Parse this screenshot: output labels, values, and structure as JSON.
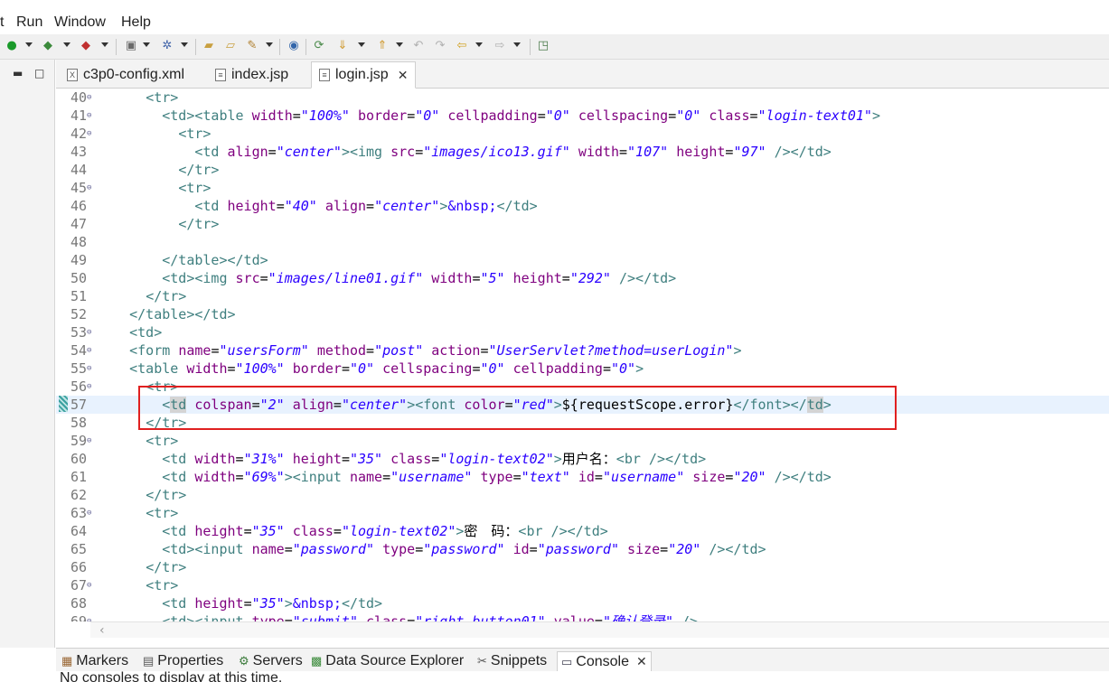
{
  "menu": [
    "t",
    "Run",
    "Window",
    "Help"
  ],
  "tabs": [
    {
      "label": "c3p0-config.xml",
      "icon": "xml-file-icon"
    },
    {
      "label": "index.jsp",
      "icon": "jsp-file-icon"
    },
    {
      "label": "login.jsp",
      "icon": "jsp-file-icon",
      "close": "✕"
    }
  ],
  "editor": {
    "current_line": "57",
    "lines": [
      {
        "n": "40",
        "fold": "⊖"
      },
      {
        "n": "41",
        "fold": "⊖"
      },
      {
        "n": "42",
        "fold": "⊖"
      },
      {
        "n": "43",
        "fold": ""
      },
      {
        "n": "44",
        "fold": ""
      },
      {
        "n": "45",
        "fold": "⊖"
      },
      {
        "n": "46",
        "fold": ""
      },
      {
        "n": "47",
        "fold": ""
      },
      {
        "n": "48",
        "fold": ""
      },
      {
        "n": "49",
        "fold": ""
      },
      {
        "n": "50",
        "fold": ""
      },
      {
        "n": "51",
        "fold": ""
      },
      {
        "n": "52",
        "fold": ""
      },
      {
        "n": "53",
        "fold": "⊖"
      },
      {
        "n": "54",
        "fold": "⊖"
      },
      {
        "n": "55",
        "fold": "⊖"
      },
      {
        "n": "56",
        "fold": "⊖"
      },
      {
        "n": "57",
        "fold": ""
      },
      {
        "n": "58",
        "fold": ""
      },
      {
        "n": "59",
        "fold": "⊖"
      },
      {
        "n": "60",
        "fold": ""
      },
      {
        "n": "61",
        "fold": ""
      },
      {
        "n": "62",
        "fold": ""
      },
      {
        "n": "63",
        "fold": "⊖"
      },
      {
        "n": "64",
        "fold": ""
      },
      {
        "n": "65",
        "fold": ""
      },
      {
        "n": "66",
        "fold": ""
      },
      {
        "n": "67",
        "fold": "⊖"
      },
      {
        "n": "68",
        "fold": ""
      },
      {
        "n": "69",
        "fold": "⊖"
      }
    ]
  },
  "bottom_tabs": [
    {
      "label": "Markers",
      "icon": "markers-icon"
    },
    {
      "label": "Properties",
      "icon": "properties-icon"
    },
    {
      "label": "Servers",
      "icon": "servers-icon"
    },
    {
      "label": "Data Source Explorer",
      "icon": "data-source-icon"
    },
    {
      "label": "Snippets",
      "icon": "snippets-icon"
    },
    {
      "label": "Console",
      "icon": "console-icon",
      "close": "✕"
    }
  ],
  "console_message": "No consoles to display at this time.",
  "colors": {
    "tag": "#3f7f7f",
    "attr": "#7f007f",
    "value": "#2a00ff",
    "highlight_box": "#e02020"
  }
}
